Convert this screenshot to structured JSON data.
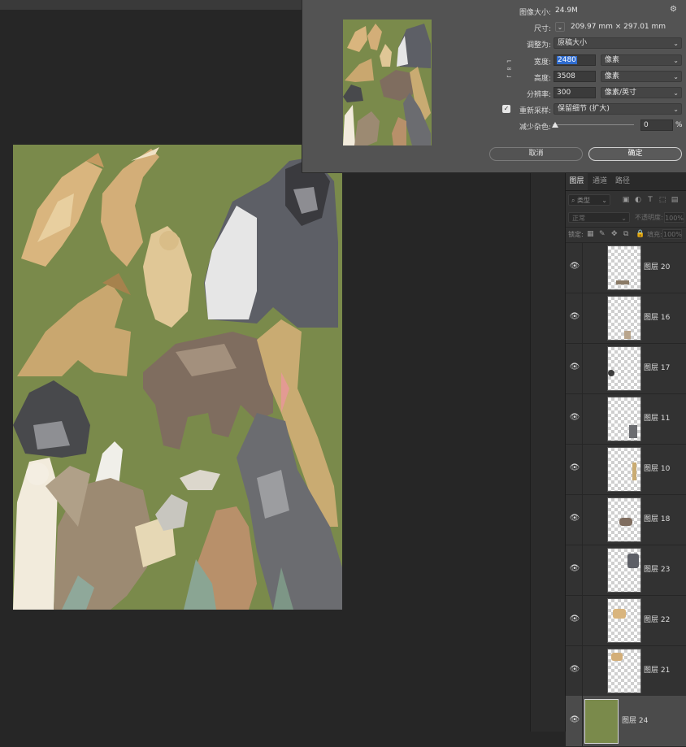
{
  "dialog": {
    "image_size_label": "图像大小:",
    "image_size_value": "24.9M",
    "dimensions_label": "尺寸:",
    "dimensions_value": "209.97 mm  ×  297.01 mm",
    "fit_to_label": "调整为:",
    "fit_to_value": "原稿大小",
    "width_label": "宽度:",
    "width_value": "2480",
    "width_unit": "像素",
    "height_label": "高度:",
    "height_value": "3508",
    "height_unit": "像素",
    "resolution_label": "分辨率:",
    "resolution_value": "300",
    "resolution_unit": "像素/英寸",
    "resample_label": "重新采样:",
    "resample_value": "保留细节 (扩大)",
    "resample_checked": true,
    "noise_label": "减少杂色:",
    "noise_value": "0",
    "noise_unit": "%",
    "cancel_label": "取消",
    "ok_label": "确定"
  },
  "layers_panel": {
    "tabs": [
      "图层",
      "通道",
      "路径"
    ],
    "active_tab": "图层",
    "filter_label": "类型",
    "blend_mode": "正常",
    "opacity_label": "不透明度:",
    "opacity_value": "100%",
    "lock_label": "锁定:",
    "fill_label": "填充:",
    "fill_value": "100%",
    "layers": [
      {
        "name": "图层 20",
        "thumb": "small animal bottom",
        "selected": false
      },
      {
        "name": "图层 16",
        "thumb": "bird",
        "selected": false
      },
      {
        "name": "图层 17",
        "thumb": "gorilla head",
        "selected": false
      },
      {
        "name": "图层 11",
        "thumb": "donkey",
        "selected": false
      },
      {
        "name": "图层 10",
        "thumb": "giraffe",
        "selected": false
      },
      {
        "name": "图层 18",
        "thumb": "rhino",
        "selected": false
      },
      {
        "name": "图层 23",
        "thumb": "gorilla",
        "selected": false
      },
      {
        "name": "图层 22",
        "thumb": "marmots",
        "selected": false
      },
      {
        "name": "图层 21",
        "thumb": "foxes",
        "selected": false
      },
      {
        "name": "图层 24",
        "thumb": "green fill",
        "selected": true
      }
    ]
  },
  "colors": {
    "canvas_green": "#7a8a4b",
    "app_background": "#262626",
    "dialog_background": "#535353",
    "selection_blue": "#2f6ccf"
  }
}
